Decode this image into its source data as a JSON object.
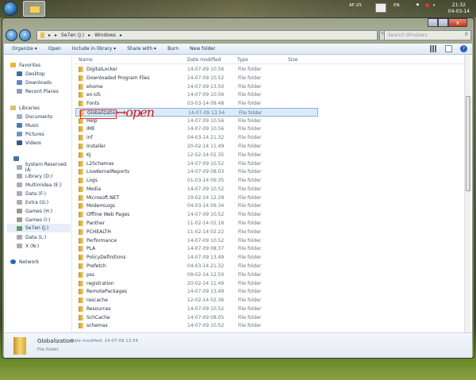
{
  "taskbar": {
    "tray_label": "AF-25",
    "language": "EN",
    "time": "21:32",
    "date": "04-03-14"
  },
  "window": {
    "close": "x",
    "address": {
      "crumbs": [
        "Se7en (J:)",
        "Windows"
      ]
    },
    "search_placeholder": "Search Windows",
    "toolbar": {
      "organize": "Organize ▾",
      "open": "Open",
      "include": "Include in library ▾",
      "share": "Share with ▾",
      "burn": "Burn",
      "new_folder": "New folder",
      "help": "?"
    },
    "sidebar": {
      "favorites": "Favorites",
      "desktop": "Desktop",
      "downloads": "Downloads",
      "recent": "Recent Places",
      "libraries": "Libraries",
      "documents": "Documents",
      "music": "Music",
      "pictures": "Pictures",
      "videos": "Videos",
      "drives": [
        "System Reserved (A:",
        "Library (D:)",
        "Multimidea (E:)",
        "Data (F:)",
        "Extra (G:)",
        "Games (H:)",
        "Games (I:)",
        "Se7en (J:)",
        "Data (L:)",
        "X (N:)"
      ],
      "network": "Network"
    },
    "columns": {
      "name": "Name",
      "date": "Date modified",
      "type": "Type",
      "size": "Size"
    },
    "files": [
      [
        "DigitalLocker",
        "14-07-09 10.56",
        "File folder"
      ],
      [
        "Downloaded Program Files",
        "14-07-09 10.52",
        "File folder"
      ],
      [
        "ehome",
        "14-07-09 13.50",
        "File folder"
      ],
      [
        "en-US",
        "14-07-09 10.56",
        "File folder"
      ],
      [
        "Fonts",
        "03-03-14 09.48",
        "File folder"
      ],
      [
        "Globalization",
        "14-07-09 13.54",
        "File folder"
      ],
      [
        "Help",
        "14-07-09 10.56",
        "File folder"
      ],
      [
        "IME",
        "14-07-09 10.56",
        "File folder"
      ],
      [
        "inf",
        "04-03-14 21.32",
        "File folder"
      ],
      [
        "Installer",
        "20-02-14 11.49",
        "File folder"
      ],
      [
        "KJ",
        "12-02-14 02.35",
        "File folder"
      ],
      [
        "L2Schemas",
        "14-07-09 10.52",
        "File folder"
      ],
      [
        "LiveKernelReports",
        "14-07-09 08.03",
        "File folder"
      ],
      [
        "Logs",
        "01-03-14 09.35",
        "File folder"
      ],
      [
        "Media",
        "14-07-09 10.52",
        "File folder"
      ],
      [
        "Microsoft.NET",
        "19-02-14 12.29",
        "File folder"
      ],
      [
        "ModemLogs",
        "04-03-14 09.34",
        "File folder"
      ],
      [
        "Offline Web Pages",
        "14-07-09 10.52",
        "File folder"
      ],
      [
        "Panther",
        "11-02-14 02.16",
        "File folder"
      ],
      [
        "PCHEALTH",
        "11-02-14 02.22",
        "File folder"
      ],
      [
        "Performance",
        "14-07-09 10.52",
        "File folder"
      ],
      [
        "PLA",
        "14-07-09 08.37",
        "File folder"
      ],
      [
        "PolicyDefinitions",
        "14-07-09 13.49",
        "File folder"
      ],
      [
        "Prefetch",
        "04-03-14 21.32",
        "File folder"
      ],
      [
        "pss",
        "09-02-14 12.50",
        "File folder"
      ],
      [
        "registration",
        "20-02-14 11.49",
        "File folder"
      ],
      [
        "RemotePackages",
        "14-07-09 13.49",
        "File folder"
      ],
      [
        "rescache",
        "12-02-14 02.36",
        "File folder"
      ],
      [
        "Resources",
        "14-07-09 10.52",
        "File folder"
      ],
      [
        "SchCache",
        "14-07-09 08.05",
        "File folder"
      ],
      [
        "schemas",
        "14-07-09 10.52",
        "File folder"
      ]
    ],
    "annotation": "→open",
    "status": {
      "name": "Globalization",
      "date_modified": "Date modified: 14-07-09 13.54",
      "type": "File folder"
    }
  }
}
